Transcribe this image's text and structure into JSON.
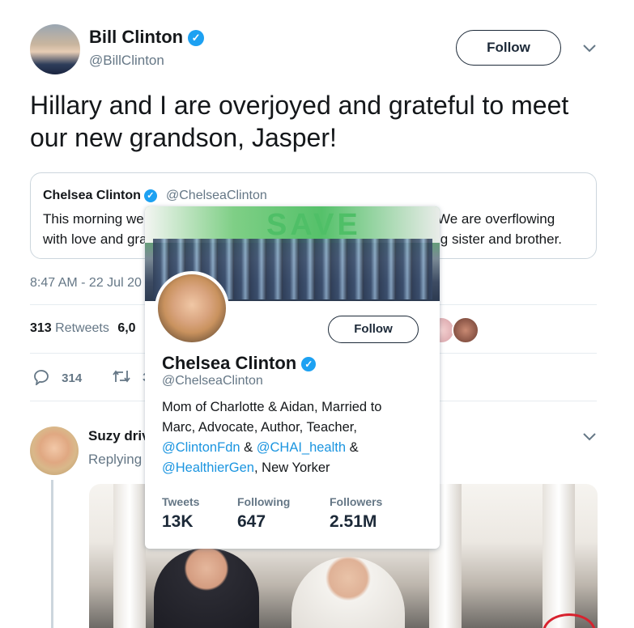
{
  "tweet": {
    "author_name": "Bill Clinton",
    "author_handle": "@BillClinton",
    "follow_label": "Follow",
    "text": "Hillary and I are overjoyed and grateful to meet our new grandson, Jasper!",
    "timestamp": "8:47 AM - 22 Jul 20",
    "stats": {
      "retweets_count": "313",
      "retweets_label": "Retweets",
      "likes_count": "6,0"
    },
    "actions": {
      "replies": "314",
      "retweets": "3"
    }
  },
  "quote": {
    "author_name": "Chelsea Clinton",
    "author_handle": "@ChelseaClinton",
    "text_left_1": "This morning we",
    "text_left_2": "with love and gra",
    "text_right_1": "We are overflowing",
    "text_right_2": "ig sister and brother."
  },
  "reply": {
    "author_name": "Suzy driv",
    "subline": "Replying"
  },
  "hover_card": {
    "banner_text": "SAVE",
    "name": "Chelsea Clinton",
    "handle": "@ChelseaClinton",
    "follow_label": "Follow",
    "bio_line1": "Mom of Charlotte & Aidan, Married to",
    "bio_line2": "Marc, Advocate, Author, Teacher,",
    "bio_link1": "@ClintonFdn",
    "bio_amp1": " & ",
    "bio_link2": "@CHAI_health",
    "bio_amp2": " &",
    "bio_link3": "@HealthierGen",
    "bio_tail": ", New Yorker",
    "stats": [
      {
        "label": "Tweets",
        "value": "13K"
      },
      {
        "label": "Following",
        "value": "647"
      },
      {
        "label": "Followers",
        "value": "2.51M"
      }
    ]
  },
  "colors": {
    "accent": "#1da1f2",
    "link": "#1b95e0",
    "text": "#14171a",
    "muted": "#657786",
    "border": "#ccd6dd"
  }
}
